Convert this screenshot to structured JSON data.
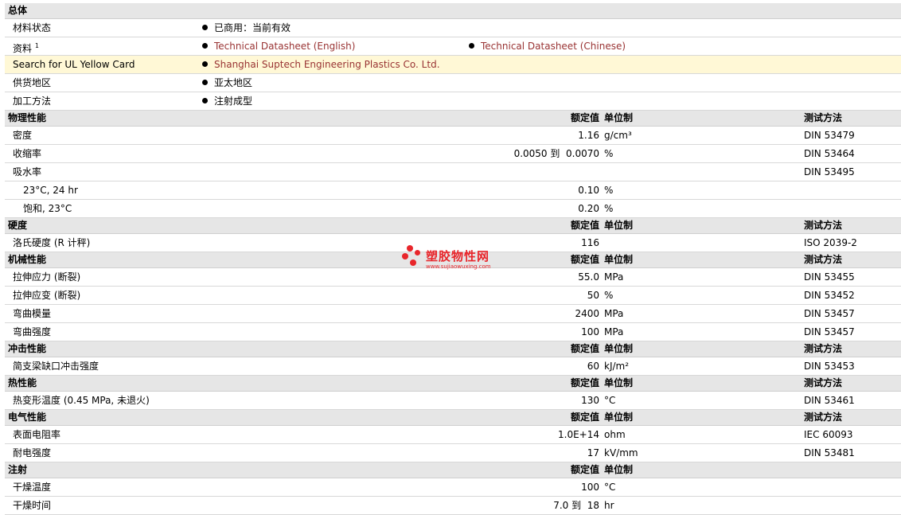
{
  "general": {
    "header": "总体",
    "material_status": {
      "label": "材料状态",
      "value": "已商用：当前有效"
    },
    "datasheets": {
      "label": "资料",
      "sup": "1",
      "links": [
        "Technical Datasheet (English)",
        "Technical Datasheet (Chinese)"
      ]
    },
    "ul": {
      "label": "Search for UL Yellow Card",
      "link": "Shanghai Suptech Engineering Plastics Co. Ltd."
    },
    "region": {
      "label": "供货地区",
      "value": "亚太地区"
    },
    "processing": {
      "label": "加工方法",
      "value": "注射成型"
    }
  },
  "col_headers": {
    "value": "额定值",
    "unit": "单位制",
    "method": "测试方法"
  },
  "physical": {
    "header": "物理性能",
    "rows": [
      {
        "label": "密度",
        "value": "1.16",
        "unit": "g/cm³",
        "method": "DIN 53479"
      },
      {
        "label": "收缩率",
        "value": "0.0050 到  0.0070",
        "unit": "%",
        "method": "DIN 53464"
      },
      {
        "label": "吸水率",
        "value": "",
        "unit": "",
        "method": "DIN 53495"
      },
      {
        "label": "23°C, 24 hr",
        "value": "0.10",
        "unit": "%",
        "method": ""
      },
      {
        "label": "饱和, 23°C",
        "value": "0.20",
        "unit": "%",
        "method": ""
      }
    ]
  },
  "hardness": {
    "header": "硬度",
    "rows": [
      {
        "label": "洛氏硬度 (R 计秤)",
        "value": "116",
        "unit": "",
        "method": "ISO 2039-2"
      }
    ]
  },
  "mechanical": {
    "header": "机械性能",
    "rows": [
      {
        "label": "拉伸应力 (断裂)",
        "value": "55.0",
        "unit": "MPa",
        "method": "DIN 53455"
      },
      {
        "label": "拉伸应变 (断裂)",
        "value": "50",
        "unit": "%",
        "method": "DIN 53452"
      },
      {
        "label": "弯曲模量",
        "value": "2400",
        "unit": "MPa",
        "method": "DIN 53457"
      },
      {
        "label": "弯曲强度",
        "value": "100",
        "unit": "MPa",
        "method": "DIN 53457"
      }
    ]
  },
  "impact": {
    "header": "冲击性能",
    "rows": [
      {
        "label": "简支梁缺口冲击强度",
        "value": "60",
        "unit": "kJ/m²",
        "method": "DIN 53453"
      }
    ]
  },
  "thermal": {
    "header": "热性能",
    "rows": [
      {
        "label": "热变形温度 (0.45 MPa, 未退火)",
        "value": "130",
        "unit": "°C",
        "method": "DIN 53461"
      }
    ]
  },
  "electrical": {
    "header": "电气性能",
    "rows": [
      {
        "label": "表面电阻率",
        "value": "1.0E+14",
        "unit": "ohm",
        "method": "IEC 60093"
      },
      {
        "label": "耐电强度",
        "value": "17",
        "unit": "kV/mm",
        "method": "DIN 53481"
      }
    ]
  },
  "injection": {
    "header": "注射",
    "rows": [
      {
        "label": "干燥温度",
        "value": "100",
        "unit": "°C",
        "method": ""
      },
      {
        "label": "干燥时间",
        "value": "7.0 到  18",
        "unit": "hr",
        "method": ""
      }
    ]
  },
  "watermark": {
    "title": "塑胶物性网",
    "url": "www.sujiaowuxing.com",
    "color": "#e8262b"
  }
}
